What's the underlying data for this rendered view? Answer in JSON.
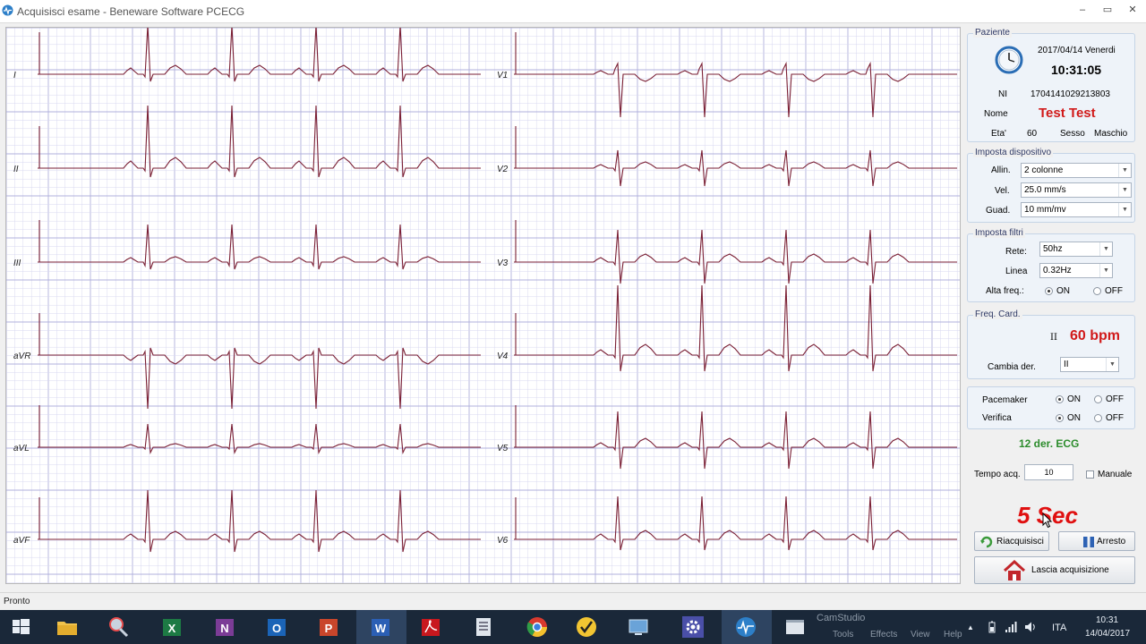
{
  "window": {
    "title": "Acquisisci esame - Beneware Software PCECG",
    "min": "–",
    "max": "▭",
    "close": "✕"
  },
  "leads_left": [
    "I",
    "II",
    "III",
    "aVR",
    "aVL",
    "aVF"
  ],
  "leads_right": [
    "V1",
    "V2",
    "V3",
    "V4",
    "V5",
    "V6"
  ],
  "patient": {
    "legend": "Paziente",
    "date": "2017/04/14 Venerdi",
    "time": "10:31:05",
    "ni_label": "NI",
    "ni_value": "1704141029213803",
    "name_label": "Nome",
    "name_value": "Test Test",
    "age_label": "Eta'",
    "age_value": "60",
    "sex_label": "Sesso",
    "sex_value": "Maschio"
  },
  "device": {
    "legend": "Imposta dispositivo",
    "allin_label": "Allin.",
    "allin_value": "2 colonne",
    "vel_label": "Vel.",
    "vel_value": "25.0 mm/s",
    "guad_label": "Guad.",
    "guad_value": "10 mm/mv"
  },
  "filters": {
    "legend": "Imposta filtri",
    "rete_label": "Rete:",
    "rete_value": "50hz",
    "linea_label": "Linea",
    "linea_value": "0.32Hz",
    "alta_label": "Alta freq.:",
    "on_label": "ON",
    "off_label": "OFF"
  },
  "heart_rate": {
    "legend": "Freq. Card.",
    "lead": "II",
    "bpm": "60 bpm",
    "cambia_label": "Cambia der.",
    "cambia_value": "II"
  },
  "pacemaker": {
    "pacemaker_label": "Pacemaker",
    "verifica_label": "Verifica",
    "on_label": "ON",
    "off_label": "OFF"
  },
  "ecg_type": "12 der. ECG",
  "acq": {
    "tempo_label": "Tempo acq.",
    "tempo_value": "10",
    "manuale_label": "Manuale",
    "countdown": "5 Sec"
  },
  "buttons": {
    "riacquisisci": "Riacquisisci",
    "arresto": "Arresto",
    "lascia": "Lascia acquisizione"
  },
  "status": "Pronto",
  "taskbar": {
    "camstudio": "CamStudio",
    "cam_menu": [
      "Tools",
      "Effects",
      "View",
      "Help"
    ],
    "lang": "ITA",
    "clock_time": "10:31",
    "clock_date": "14/04/2017"
  },
  "colors": {
    "ecg_trace": "#7a1f34",
    "grid_minor": "#d8d8f0",
    "grid_major": "#b0b0dc",
    "accent_red": "#d11a1a",
    "green": "#2c8c2c"
  }
}
